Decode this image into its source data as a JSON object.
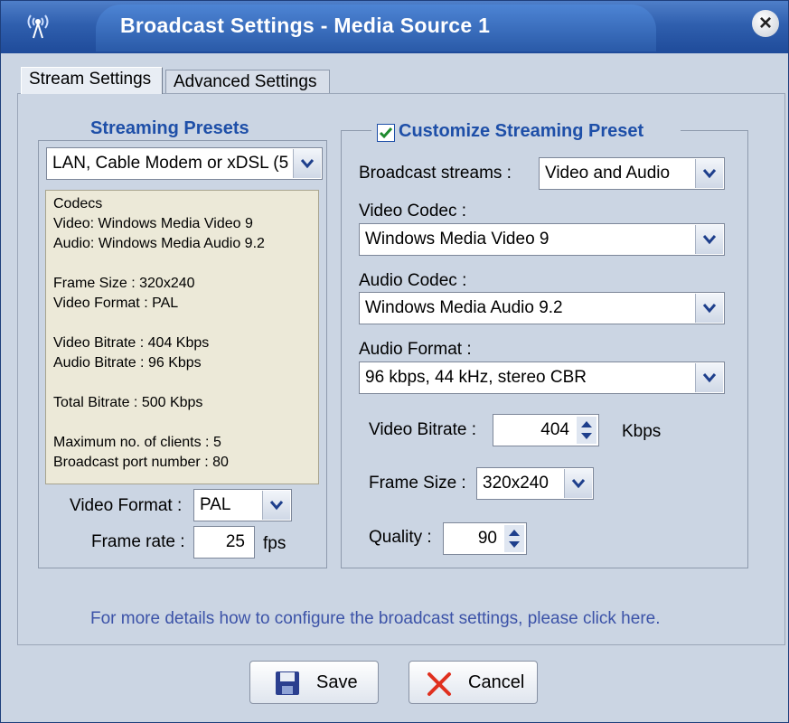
{
  "window": {
    "title": "Broadcast Settings - Media Source 1",
    "close_glyph": "×"
  },
  "tabs": [
    {
      "label": "Stream Settings",
      "active": true
    },
    {
      "label": "Advanced Settings",
      "active": false
    }
  ],
  "presets": {
    "title": "Streaming Presets",
    "selected": "LAN, Cable Modem or xDSL (5",
    "info_lines": [
      "Codecs",
      "Video: Windows Media Video 9",
      "Audio: Windows Media Audio 9.2",
      "Frame Size  :      320x240",
      "Video Format :      PAL",
      "Video Bitrate :    404 Kbps",
      "Audio Bitrate :    96 Kbps",
      "Total Bitrate  :    500 Kbps",
      "Maximum no. of clients :    5",
      "Broadcast port number  :    80"
    ],
    "video_format_label": "Video Format :",
    "video_format_value": "PAL",
    "frame_rate_label": "Frame rate :",
    "frame_rate_value": "25",
    "frame_rate_unit": "fps"
  },
  "custom": {
    "title": "Customize Streaming Preset",
    "checked": true,
    "broadcast_streams_label": "Broadcast streams :",
    "broadcast_streams_value": "Video and Audio",
    "video_codec_label": "Video Codec :",
    "video_codec_value": "Windows Media Video 9",
    "audio_codec_label": "Audio Codec :",
    "audio_codec_value": "Windows Media Audio 9.2",
    "audio_format_label": "Audio Format :",
    "audio_format_value": "96 kbps, 44 kHz, stereo CBR",
    "video_bitrate_label": "Video Bitrate :",
    "video_bitrate_value": "404",
    "video_bitrate_unit": "Kbps",
    "frame_size_label": "Frame Size :",
    "frame_size_value": "320x240",
    "quality_label": "Quality :",
    "quality_value": "90"
  },
  "help_link": "For more details how to configure the broadcast settings, please click here.",
  "buttons": {
    "save": "Save",
    "cancel": "Cancel"
  },
  "colors": {
    "title_bar": "#2f5fae",
    "accent_text": "#1e4fa8",
    "link": "#3c53a8",
    "panel_bg": "#cbd5e3",
    "info_bg": "#ece9d8"
  }
}
